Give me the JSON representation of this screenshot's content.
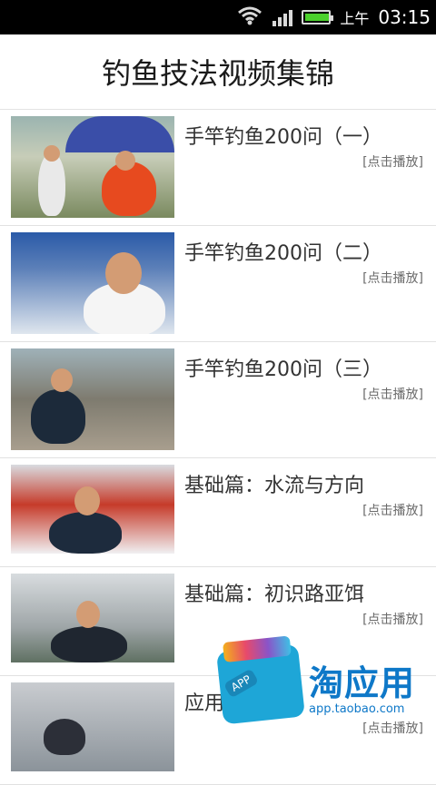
{
  "status": {
    "ampm": "上午",
    "time": "03:15",
    "battery_level": 0.95,
    "accent_color": "#4bd12c"
  },
  "page": {
    "title": "钓鱼技法视频集锦"
  },
  "items": [
    {
      "title": "手竿钓鱼200问（一）",
      "action": "[点击播放]"
    },
    {
      "title": "手竿钓鱼200问（二）",
      "action": "[点击播放]"
    },
    {
      "title": "手竿钓鱼200问（三）",
      "action": "[点击播放]"
    },
    {
      "title": "基础篇：水流与方向",
      "action": "[点击播放]"
    },
    {
      "title": "基础篇：初识路亚饵",
      "action": "[点击播放]"
    },
    {
      "title": "应用",
      "action": "[点击播放]"
    }
  ],
  "watermark": {
    "brand": "淘应用",
    "url": "app.taobao.com",
    "tag": "APP"
  }
}
